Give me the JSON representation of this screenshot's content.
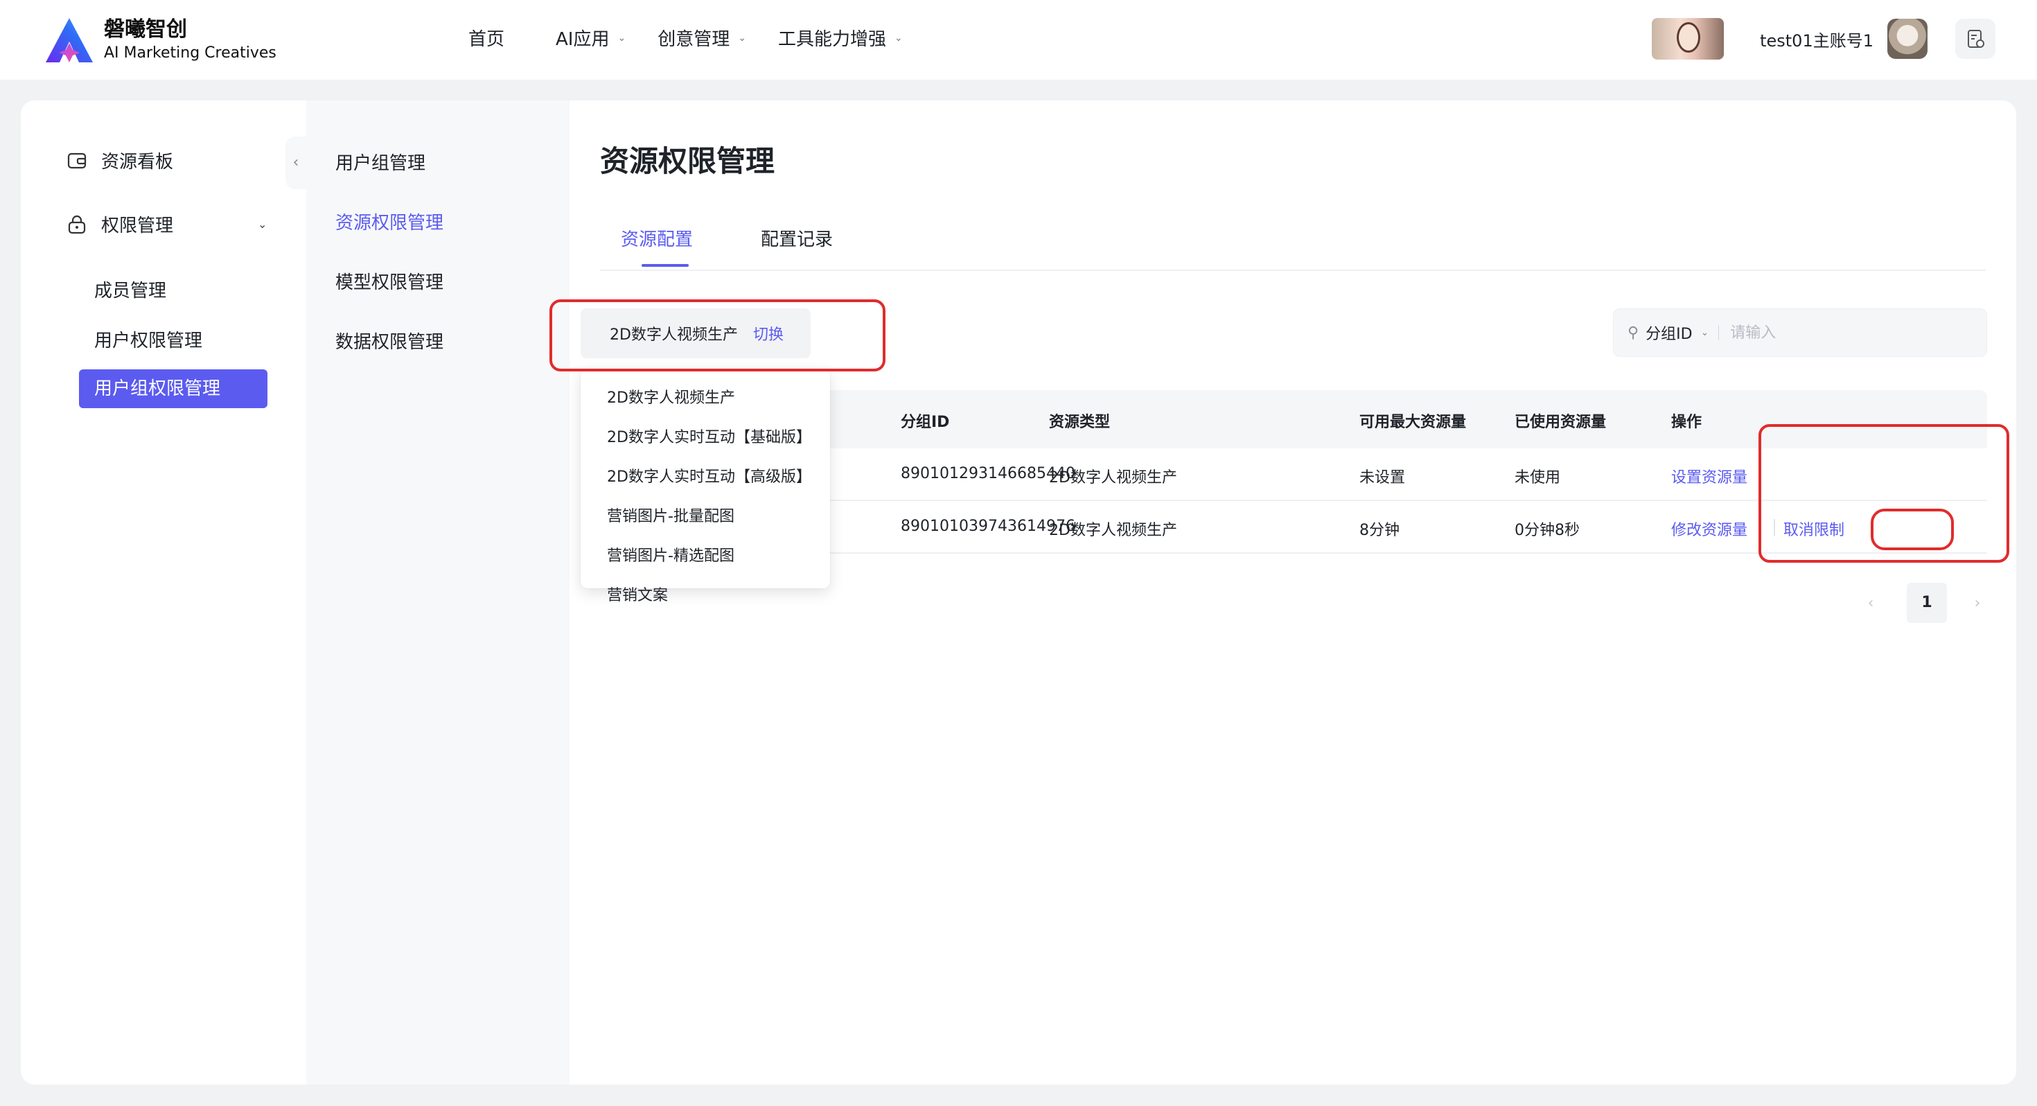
{
  "header": {
    "logo_cn": "磐曦智创",
    "logo_en": "AI Marketing Creatives",
    "nav": [
      {
        "label": "首页"
      },
      {
        "label": "AI应用"
      },
      {
        "label": "创意管理"
      },
      {
        "label": "工具能力增强"
      }
    ],
    "username": "test01主账号1",
    "help_icon": "help-doc-icon"
  },
  "sidebar": {
    "items": [
      {
        "label": "资源看板",
        "icon": "wallet-icon"
      },
      {
        "label": "权限管理",
        "icon": "lock-icon"
      }
    ],
    "sub_items": [
      {
        "label": "成员管理"
      },
      {
        "label": "用户权限管理"
      },
      {
        "label": "用户组权限管理"
      }
    ]
  },
  "submenu": {
    "items": [
      {
        "label": "用户组管理"
      },
      {
        "label": "资源权限管理"
      },
      {
        "label": "模型权限管理"
      },
      {
        "label": "数据权限管理"
      }
    ]
  },
  "main": {
    "title": "资源权限管理",
    "tabs": [
      {
        "label": "资源配置"
      },
      {
        "label": "配置记录"
      }
    ],
    "resource": {
      "current": "2D数字人视频生产",
      "switch_label": "切换"
    },
    "dropdown": [
      "2D数字人视频生产",
      "2D数字人实时互动【基础版】",
      "2D数字人实时互动【高级版】",
      "营销图片-批量配图",
      "营销图片-精选配图",
      "营销文案"
    ],
    "search": {
      "field": "分组ID",
      "placeholder": "请输入"
    },
    "table": {
      "headers": [
        "分组ID",
        "资源类型",
        "可用最大资源量",
        "已使用资源量",
        "操作"
      ],
      "rows": [
        {
          "group_id": "890101293146685440",
          "type": "2D数字人视频生产",
          "max": "未设置",
          "used": "未使用",
          "actions": [
            "设置资源量"
          ]
        },
        {
          "group_id": "890101039743614976",
          "type": "2D数字人视频生产",
          "max": "8分钟",
          "used": "0分钟8秒",
          "actions": [
            "修改资源量",
            "取消限制"
          ]
        }
      ]
    },
    "pagination": {
      "current": "1"
    }
  },
  "colors": {
    "accent": "#5b5bf0",
    "annotation_red": "#e02c2c",
    "page_bg": "#f1f2f4"
  }
}
